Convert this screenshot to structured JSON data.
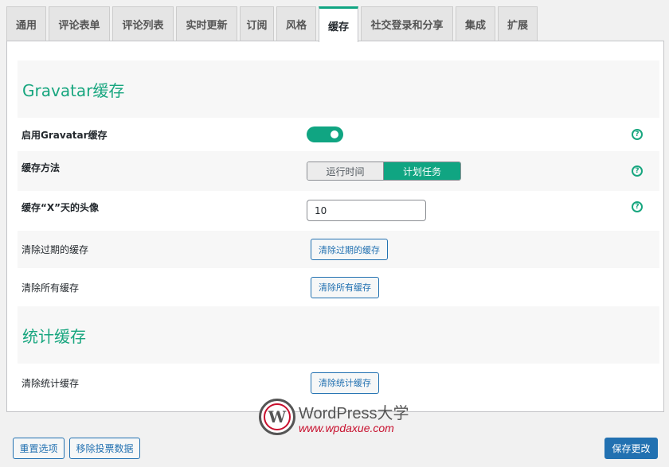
{
  "tabs": [
    {
      "label": "通用"
    },
    {
      "label": "评论表单"
    },
    {
      "label": "评论列表"
    },
    {
      "label": "实时更新"
    },
    {
      "label": "订阅"
    },
    {
      "label": "风格"
    },
    {
      "label": "缓存",
      "active": true
    },
    {
      "label": "社交登录和分享"
    },
    {
      "label": "集成"
    },
    {
      "label": "扩展"
    }
  ],
  "gravatar": {
    "section_title": "Gravatar缓存",
    "enable_label": "启用Gravatar缓存",
    "enable_value": true,
    "method_label": "缓存方法",
    "method_options": [
      "运行时间",
      "计划任务"
    ],
    "method_selected": "计划任务",
    "days_label": "缓存“X”天的头像",
    "days_value": "10",
    "clear_expired_label": "清除过期的缓存",
    "clear_expired_button": "清除过期的缓存",
    "clear_all_label": "清除所有缓存",
    "clear_all_button": "清除所有缓存",
    "help_glyph": "?"
  },
  "stats": {
    "section_title": "统计缓存",
    "clear_label": "清除统计缓存",
    "clear_button": "清除统计缓存"
  },
  "footer": {
    "reset_button": "重置选项",
    "remove_votes_button": "移除投票数据",
    "save_button": "保存更改"
  },
  "watermark": {
    "logo_letter": "W",
    "title": "WordPress大学",
    "url": "www.wpdaxue.com"
  },
  "colors": {
    "accent": "#10a582",
    "link": "#2271b1"
  }
}
